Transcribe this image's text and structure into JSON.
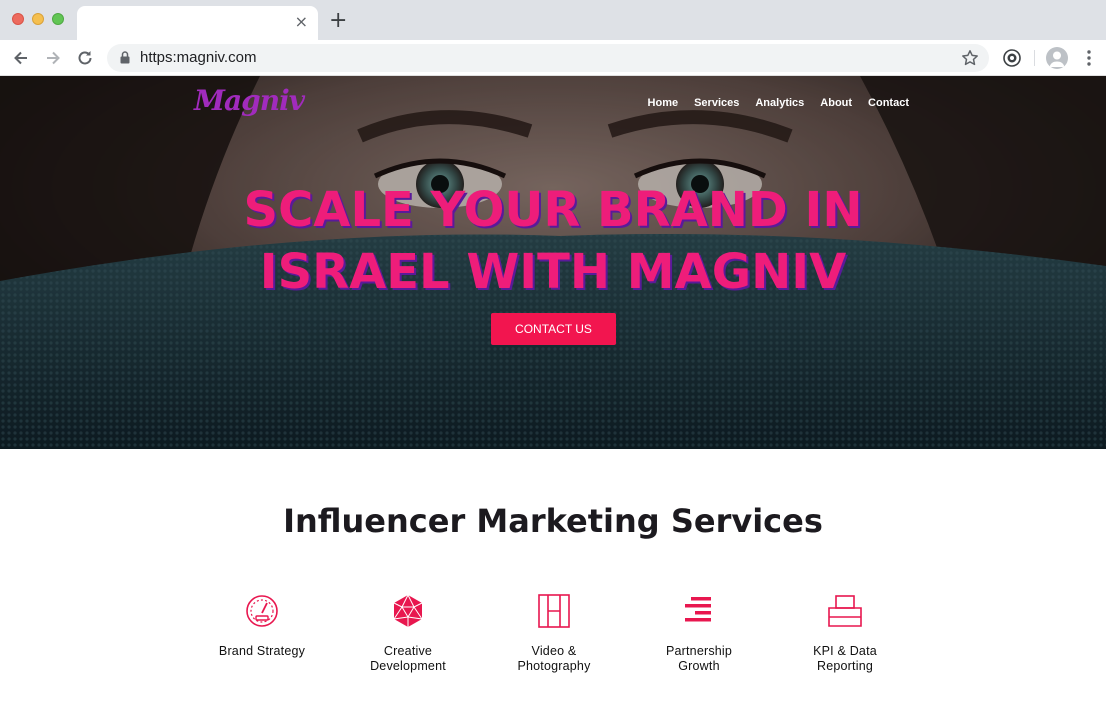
{
  "browser": {
    "url": "https:magniv.com",
    "new_tab_symbol": "+",
    "close_symbol": "×"
  },
  "site": {
    "logo_text": "Magniv",
    "nav": [
      "Home",
      "Services",
      "Analytics",
      "About",
      "Contact"
    ],
    "headline_line1": "SCALE YOUR BRAND IN",
    "headline_line2": "ISRAEL WITH MAGNIV",
    "cta_label": "CONTACT US",
    "section_title": "Influencer Marketing Services",
    "services": [
      {
        "label": "Brand Strategy",
        "icon": "speedometer-icon"
      },
      {
        "label": "Creative\nDevelopment",
        "icon": "polyhedron-icon"
      },
      {
        "label": "Video &\nPhotography",
        "icon": "grid-frame-icon"
      },
      {
        "label": "Partnership\nGrowth",
        "icon": "bars-icon"
      },
      {
        "label": "KPI & Data\nReporting",
        "icon": "report-tray-icon"
      }
    ]
  },
  "colors": {
    "accent": "#ee1d7a",
    "cta": "#f2154f",
    "icon": "#e8174f",
    "logo": "#a12bbd"
  }
}
